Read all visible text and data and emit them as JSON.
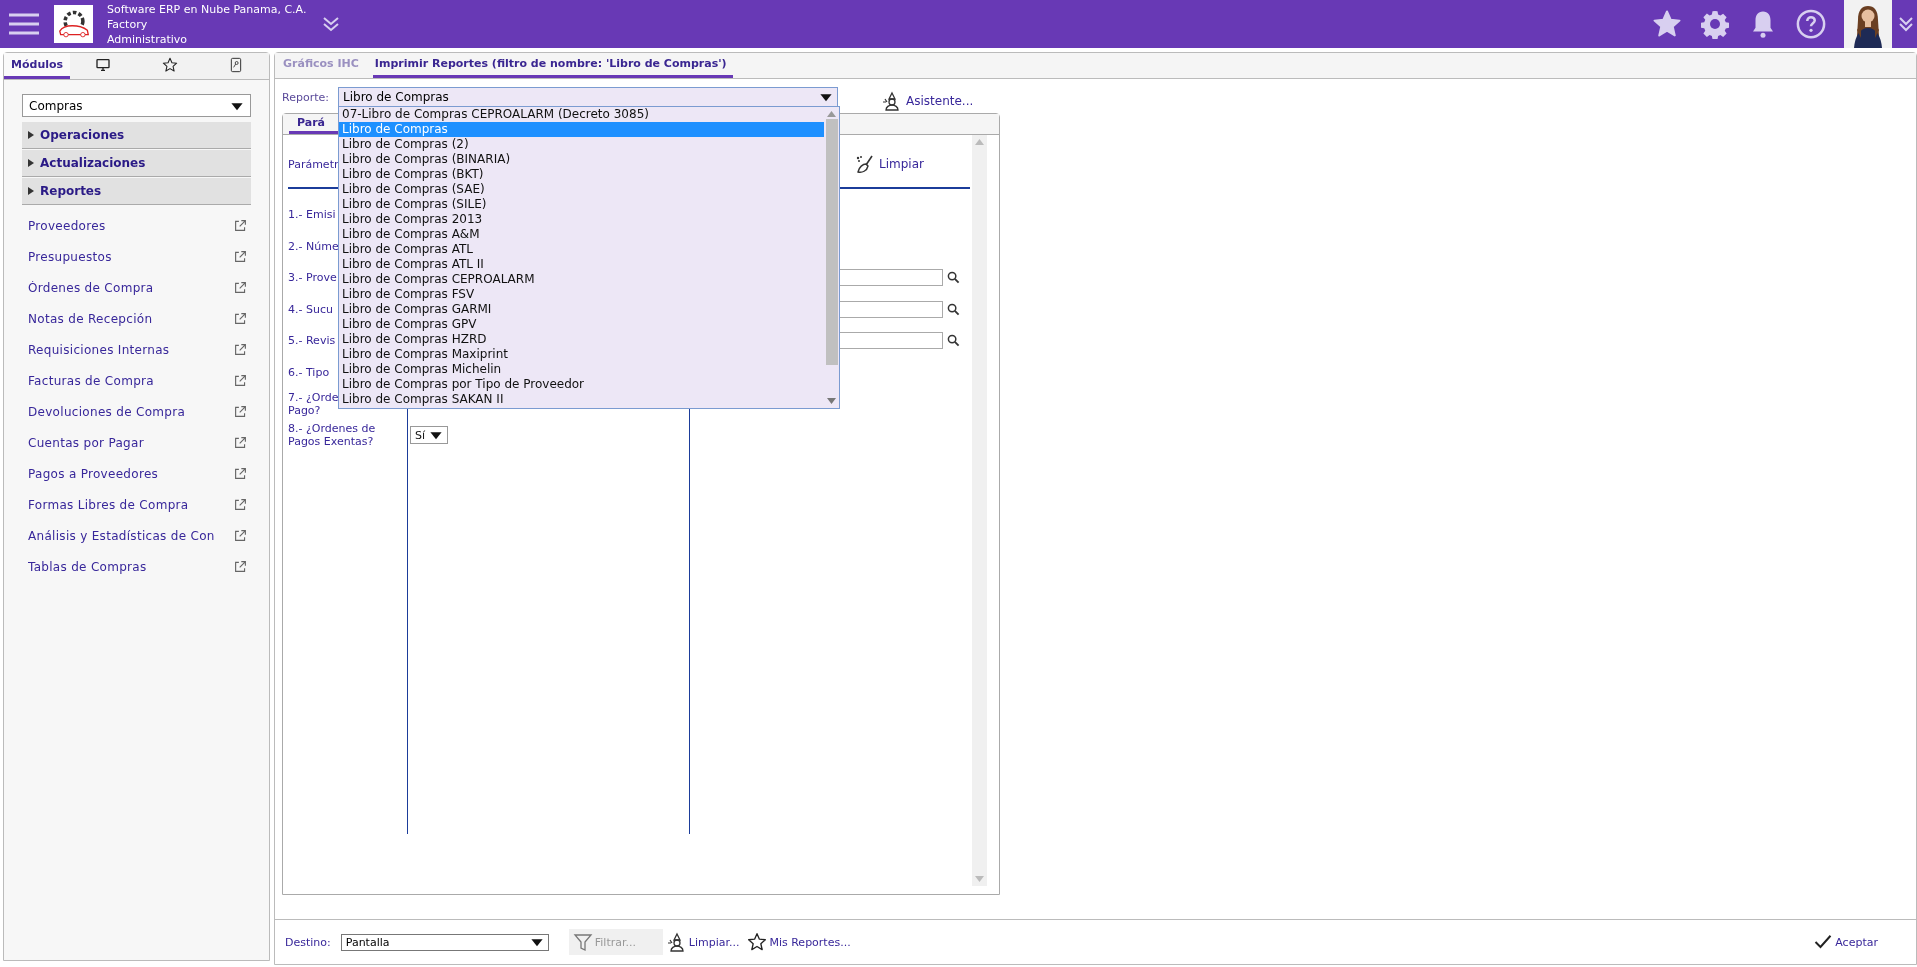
{
  "header": {
    "company": "Software ERP en Nube Panama, C.A.",
    "site": "Factory",
    "role": "Administrativo"
  },
  "sidebar": {
    "tabs": [
      {
        "kind": "text",
        "label": "Módulos",
        "selected": true
      },
      {
        "kind": "monitor",
        "selected": false
      },
      {
        "kind": "star",
        "selected": false
      },
      {
        "kind": "document",
        "selected": false
      }
    ],
    "module": "Compras",
    "sections": [
      {
        "label": "Operaciones",
        "expanded": false
      },
      {
        "label": "Actualizaciones",
        "expanded": false
      },
      {
        "label": "Reportes",
        "expanded": false
      }
    ],
    "links": [
      "Proveedores",
      "Presupuestos",
      "Órdenes de Compra",
      "Notas de Recepción",
      "Requisiciones Internas",
      "Facturas de Compra",
      "Devoluciones de Compra",
      "Cuentas por Pagar",
      "Pagos a Proveedores",
      "Formas Libres de Compra",
      "Análisis y Estadísticas de Con",
      "Tablas de Compras"
    ]
  },
  "main_tabs": [
    {
      "label": "Gráficos IHC",
      "selected": false
    },
    {
      "label": "Imprimir Reportes (filtro de nombre: 'Libro de Compras')",
      "selected": true
    }
  ],
  "report": {
    "label": "Reporte:",
    "value": "Libro de Compras",
    "expanded": true,
    "options": [
      {
        "label": "07-Libro de Compras CEPROALARM (Decreto 3085)",
        "selected": false
      },
      {
        "label": "Libro de Compras",
        "selected": true
      },
      {
        "label": "Libro de Compras (2)",
        "selected": false
      },
      {
        "label": "Libro de Compras (BINARIA)",
        "selected": false
      },
      {
        "label": "Libro de Compras (BKT)",
        "selected": false
      },
      {
        "label": "Libro de Compras (SAE)",
        "selected": false
      },
      {
        "label": "Libro de Compras (SILE)",
        "selected": false
      },
      {
        "label": "Libro de Compras 2013",
        "selected": false
      },
      {
        "label": "Libro de Compras A&M",
        "selected": false
      },
      {
        "label": "Libro de Compras ATL",
        "selected": false
      },
      {
        "label": "Libro de Compras ATL II",
        "selected": false
      },
      {
        "label": "Libro de Compras CEPROALARM",
        "selected": false
      },
      {
        "label": "Libro de Compras FSV",
        "selected": false
      },
      {
        "label": "Libro de Compras GARMI",
        "selected": false
      },
      {
        "label": "Libro de Compras GPV",
        "selected": false
      },
      {
        "label": "Libro de Compras HZRD",
        "selected": false
      },
      {
        "label": "Libro de Compras Maxiprint",
        "selected": false
      },
      {
        "label": "Libro de Compras Michelin",
        "selected": false
      },
      {
        "label": "Libro de Compras por Tipo de Proveedor",
        "selected": false
      },
      {
        "label": "Libro de Compras SAKAN II",
        "selected": false
      }
    ]
  },
  "assistant": "Asistente...",
  "params": {
    "tab": {
      "label": "Pará",
      "selected": true
    },
    "title": "Parámetr",
    "clear": "Limpiar",
    "rows": [
      {
        "kind": "text",
        "lines": [
          "1.- Emisi"
        ]
      },
      {
        "kind": "text",
        "lines": [
          "2.- Núme"
        ]
      },
      {
        "kind": "lookup",
        "lines": [
          "3.- Prove"
        ]
      },
      {
        "kind": "lookup",
        "lines": [
          "4.- Sucu"
        ]
      },
      {
        "kind": "lookup",
        "lines": [
          "5.- Revis"
        ]
      },
      {
        "kind": "text",
        "lines": [
          "6.- Tipo"
        ]
      },
      {
        "kind": "text",
        "lines": [
          "7.- ¿Orde",
          "Pago?"
        ]
      },
      {
        "kind": "select",
        "lines": [
          "8.- ¿Ordenes de",
          "Pagos Exentas?"
        ],
        "value": "Sí"
      }
    ]
  },
  "footer": {
    "destination_label": "Destino:",
    "destination": "Pantalla",
    "filter": {
      "label": "Filtrar...",
      "disabled": true
    },
    "clear": "Limpiar...",
    "my_reports": "Mis Reportes...",
    "accept": "Aceptar"
  }
}
